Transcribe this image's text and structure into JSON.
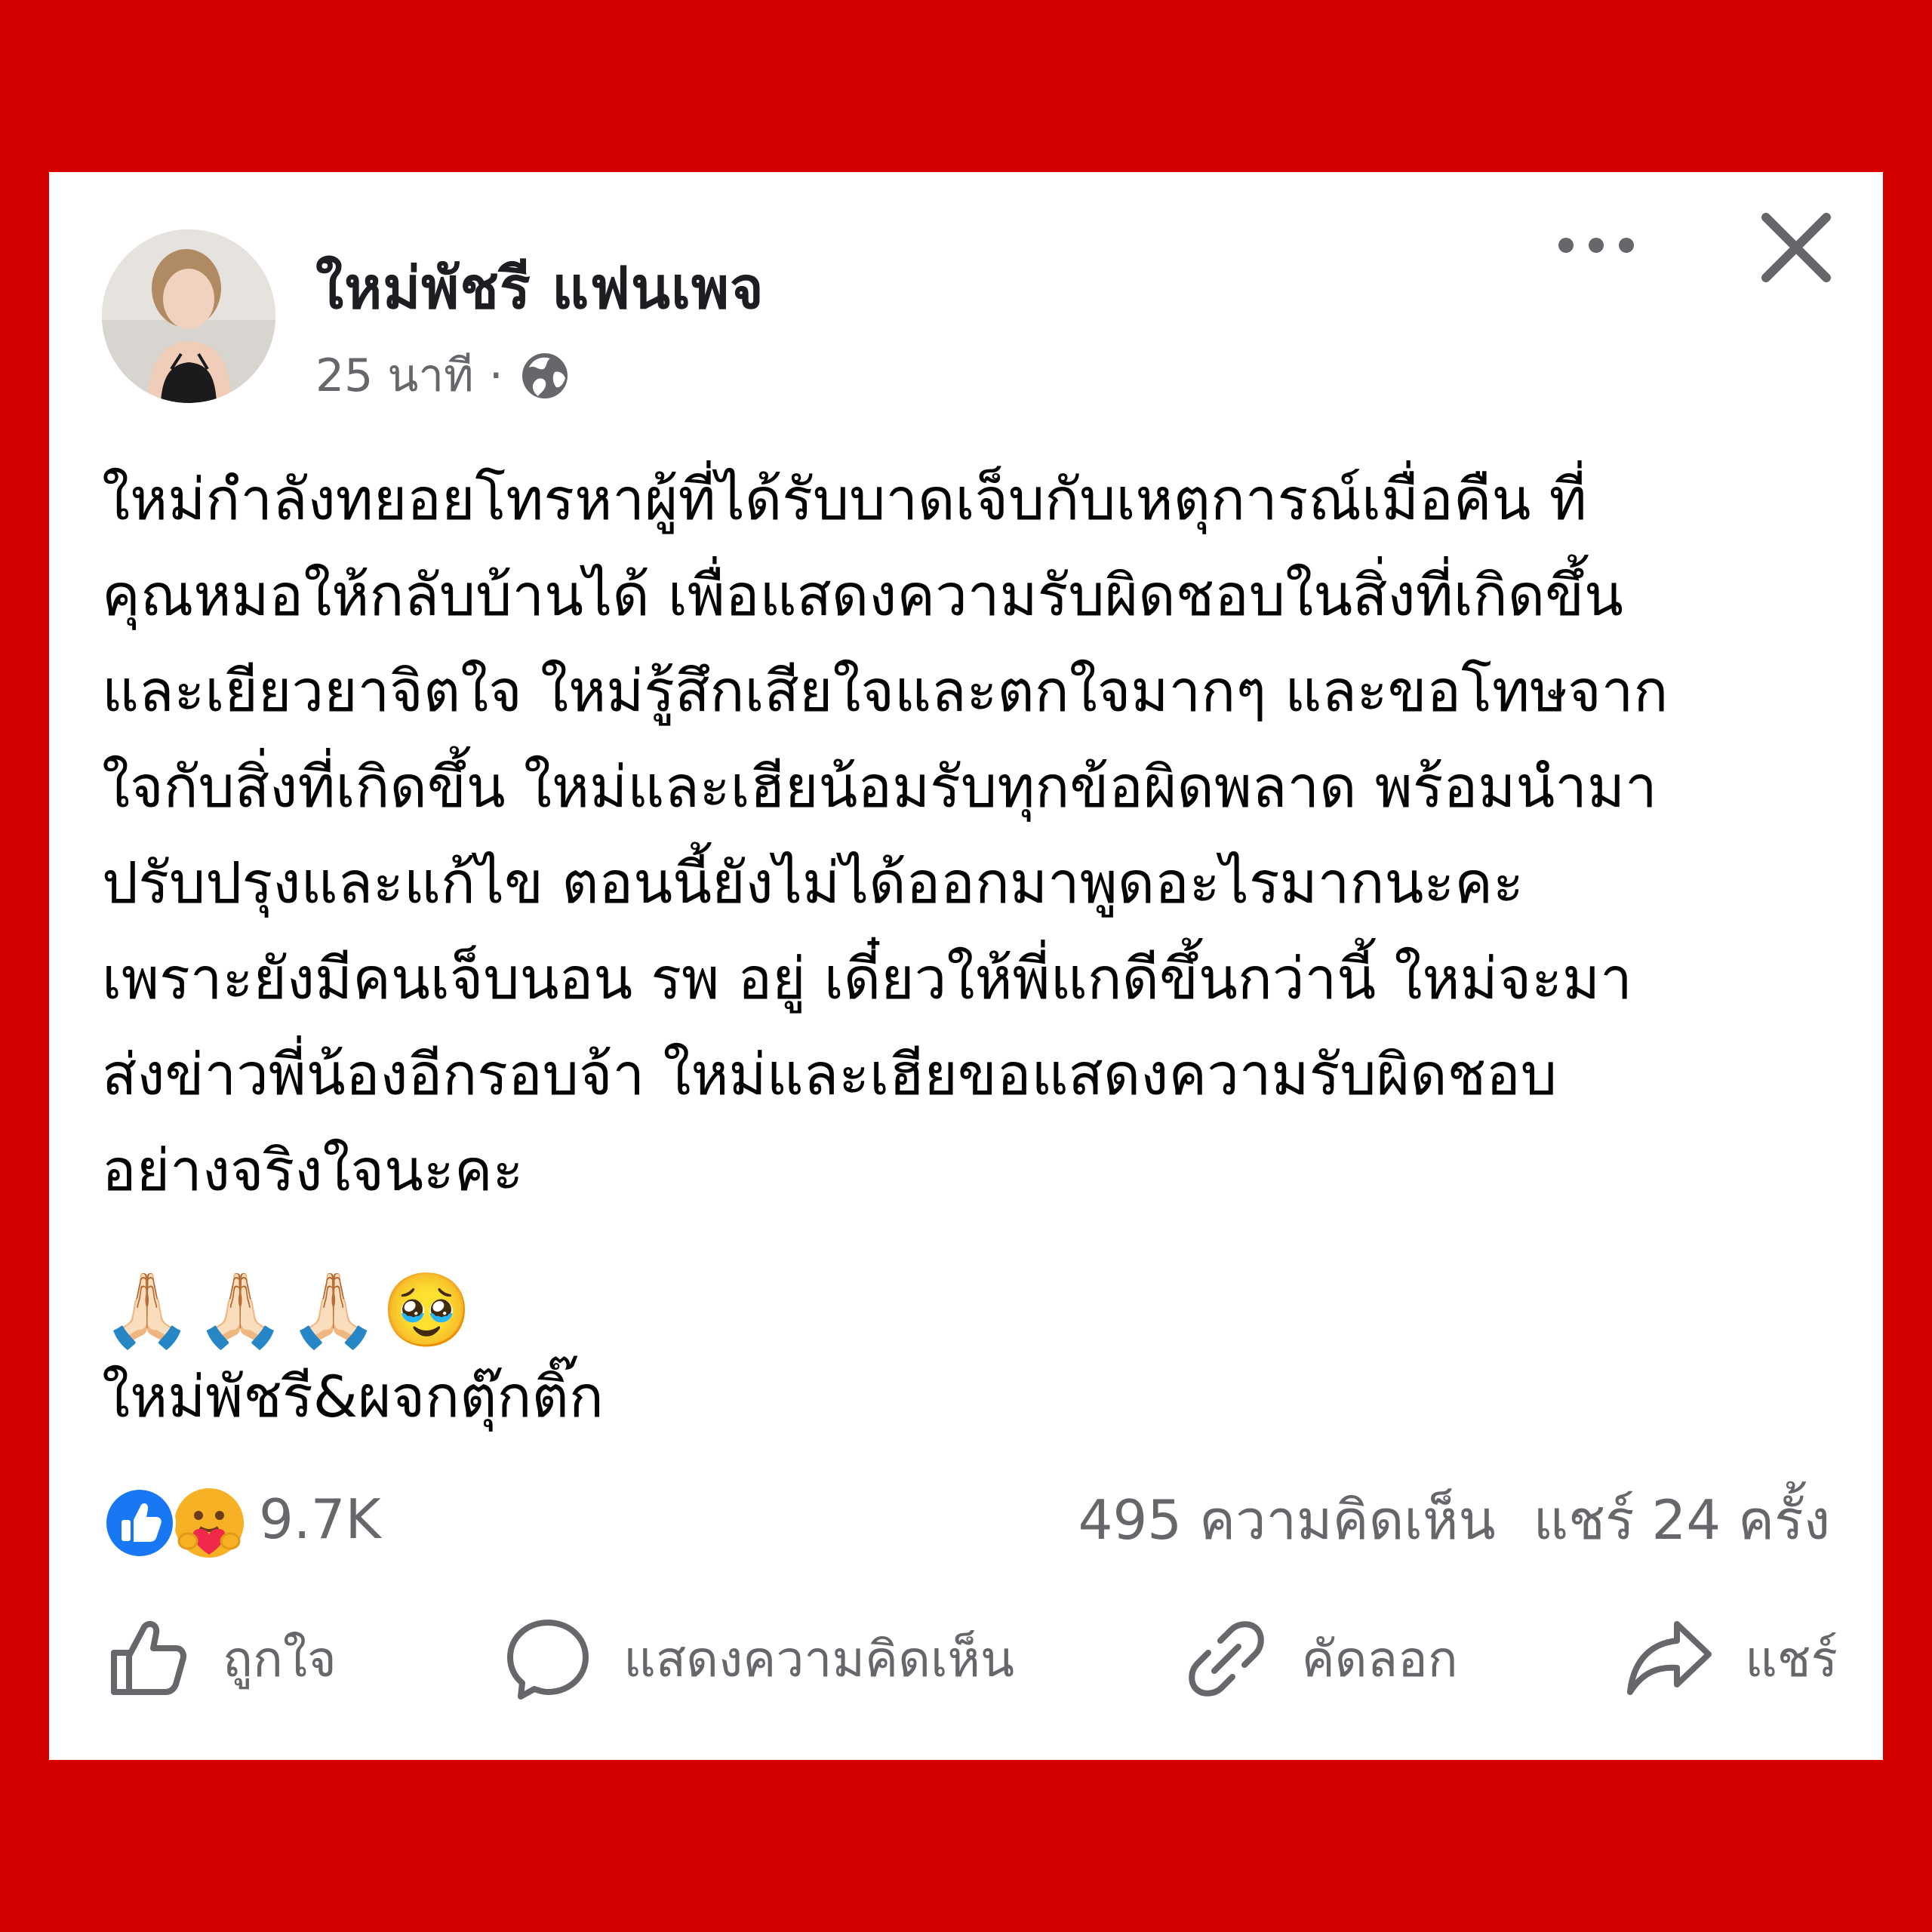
{
  "post": {
    "author": "ใหม่พัชรี  แฟนเพจ",
    "time": "25 นาที",
    "separator": "·",
    "privacy_icon": "globe-icon",
    "body": "ใหม่กำลังทยอยโทรหาผู้ที่ได้รับบาดเจ็บกับเหตุการณ์เมื่อคืน ที่\nคุณหมอให้กลับบ้านได้ เพื่อแสดงความรับผิดชอบในสิ่งที่เกิดขึ้น\nและเยียวยาจิตใจ ใหม่รู้สึกเสียใจและตกใจมากๆ และขอโทษจาก\nใจกับสิ่งที่เกิดขึ้น ใหม่และเฮียน้อมรับทุกข้อผิดพลาด พร้อมนำมา\nปรับปรุงและแก้ไข ตอนนี้ยังไม่ได้ออกมาพูดอะไรมากนะคะ\nเพราะยังมีคนเจ็บนอน รพ อยู่ เดี๋ยวให้พี่แกดีขึ้นกว่านี้ ใหม่จะมา\nส่งข่าวพี่น้องอีกรอบจ้า ใหม่และเฮียขอแสดงความรับผิดชอบ\nอย่างจริงใจนะคะ",
    "emojis": "🙏🏻🙏🏻🙏🏻🥹",
    "signature": "ใหม่พัชรี&ผจกตุ๊กติ๊ก"
  },
  "stats": {
    "reaction_count": "9.7K",
    "comments": "495 ความคิดเห็น",
    "shares": "แชร์ 24 ครั้ง"
  },
  "actions": {
    "like": "ถูกใจ",
    "comment": "แสดงความคิดเห็น",
    "copy": "คัดลอก",
    "share": "แชร์"
  },
  "colors": {
    "frame": "#d40000",
    "card": "#ffffff",
    "secondary_text": "#65676b",
    "like_blue": "#1877f2"
  }
}
